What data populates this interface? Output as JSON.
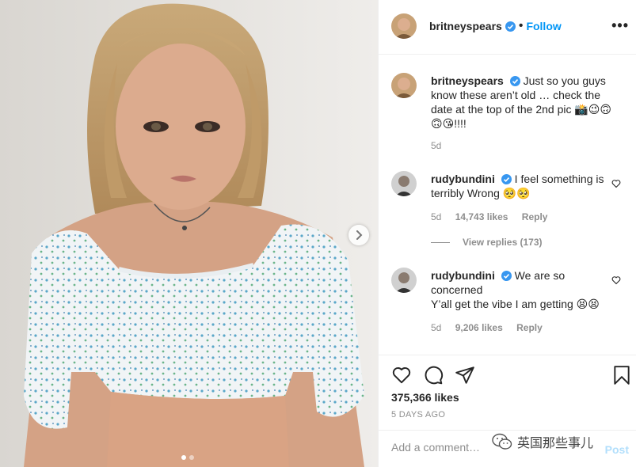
{
  "post": {
    "username": "britneyspears",
    "follow_label": "Follow",
    "more_label": "•••",
    "caption": "Just so you guys know these aren’t old … check the date at the top of the 2nd pic 📸😉🙃🙃😘!!!!",
    "caption_time": "5d"
  },
  "comments": [
    {
      "username": "rudybundini",
      "text": "I feel something is terribly Wrong 🥺🥺",
      "time": "5d",
      "likes": "14,743 likes",
      "reply_label": "Reply"
    },
    {
      "username": "rudybundini",
      "text": "We are so concerned\nY’all get the vibe I am getting 😫😫",
      "time": "5d",
      "likes": "9,206 likes",
      "reply_label": "Reply"
    }
  ],
  "view_replies": "View replies (173)",
  "likes_count": "375,366 likes",
  "date": "5 DAYS AGO",
  "add_comment": {
    "placeholder": "Add a comment…",
    "post_label": "Post"
  },
  "watermark": "英国那些事儿",
  "carousel": {
    "total": 2,
    "current": 1
  },
  "colors": {
    "accent": "#0095f6",
    "muted": "#8e8e8e",
    "post_disabled": "#b2dffc",
    "text": "#262626"
  }
}
